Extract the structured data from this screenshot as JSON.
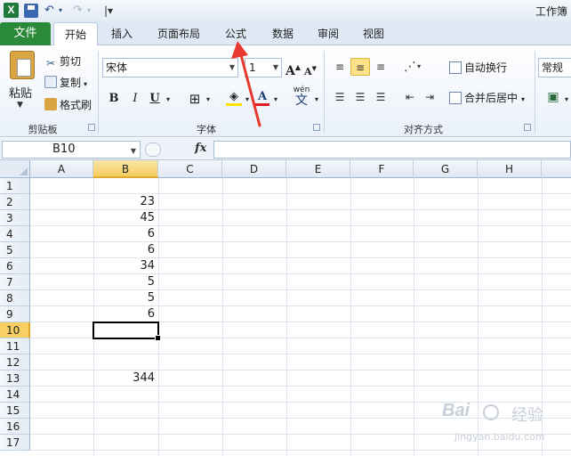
{
  "window": {
    "title": "工作簿"
  },
  "qat": {
    "separator": "|▾"
  },
  "tabs": {
    "file": "文件",
    "items": [
      "开始",
      "插入",
      "页面布局",
      "公式",
      "数据",
      "审阅",
      "视图"
    ]
  },
  "clipboard": {
    "paste": "粘贴",
    "cut": "剪切",
    "copy": "复制",
    "format_painter": "格式刷",
    "label": "剪贴板"
  },
  "font": {
    "name": "宋体",
    "size": "1",
    "bold": "B",
    "italic": "I",
    "underline": "U",
    "grow": "A",
    "shrink": "A",
    "color_letter": "A",
    "phonetic": "wén",
    "phonetic_char": "文",
    "label": "字体"
  },
  "alignment": {
    "wrap_text": "自动换行",
    "merge_center": "合并后居中",
    "label": "对齐方式"
  },
  "number": {
    "format": "常规"
  },
  "formula_bar": {
    "name_box": "B10",
    "fx": "fx",
    "formula": ""
  },
  "grid": {
    "columns": [
      "A",
      "B",
      "C",
      "D",
      "E",
      "F",
      "G",
      "H"
    ],
    "rows": [
      "1",
      "2",
      "3",
      "4",
      "5",
      "6",
      "7",
      "8",
      "9",
      "10",
      "11",
      "12",
      "13",
      "14",
      "15",
      "16",
      "17"
    ],
    "selected_cell": "B10",
    "values": {
      "B2": "23",
      "B3": "45",
      "B4": "6",
      "B5": "6",
      "B6": "34",
      "B7": "5",
      "B8": "5",
      "B9": "6",
      "B13": "344"
    }
  },
  "watermark": {
    "brand": "Bai",
    "sub": "经验",
    "url": "jingyan.baidu.com"
  },
  "colors": {
    "file_tab": "#2a8a3a",
    "selection": "#f6cd5e",
    "arrow": "#e8392e"
  }
}
